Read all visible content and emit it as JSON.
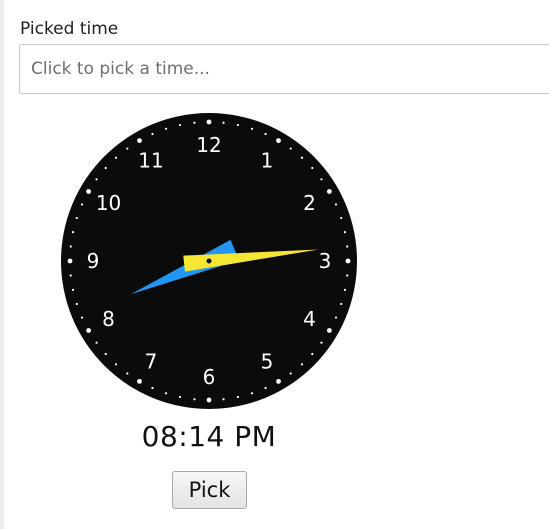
{
  "form": {
    "label": "Picked time",
    "input_placeholder": "Click to pick a time...",
    "input_value": ""
  },
  "clock": {
    "numbers": [
      "12",
      "1",
      "2",
      "3",
      "4",
      "5",
      "6",
      "7",
      "8",
      "9",
      "10",
      "11"
    ],
    "hour": 8,
    "minute": 14,
    "colors": {
      "face": "#0b0b0b",
      "face_center": "#000000",
      "ticks": "#ffffff",
      "hour_hand": "#2196f3",
      "minute_hand": "#f7e733",
      "pivot": "#111111"
    }
  },
  "digital": {
    "time": "08:14 PM"
  },
  "actions": {
    "pick_label": "Pick"
  }
}
